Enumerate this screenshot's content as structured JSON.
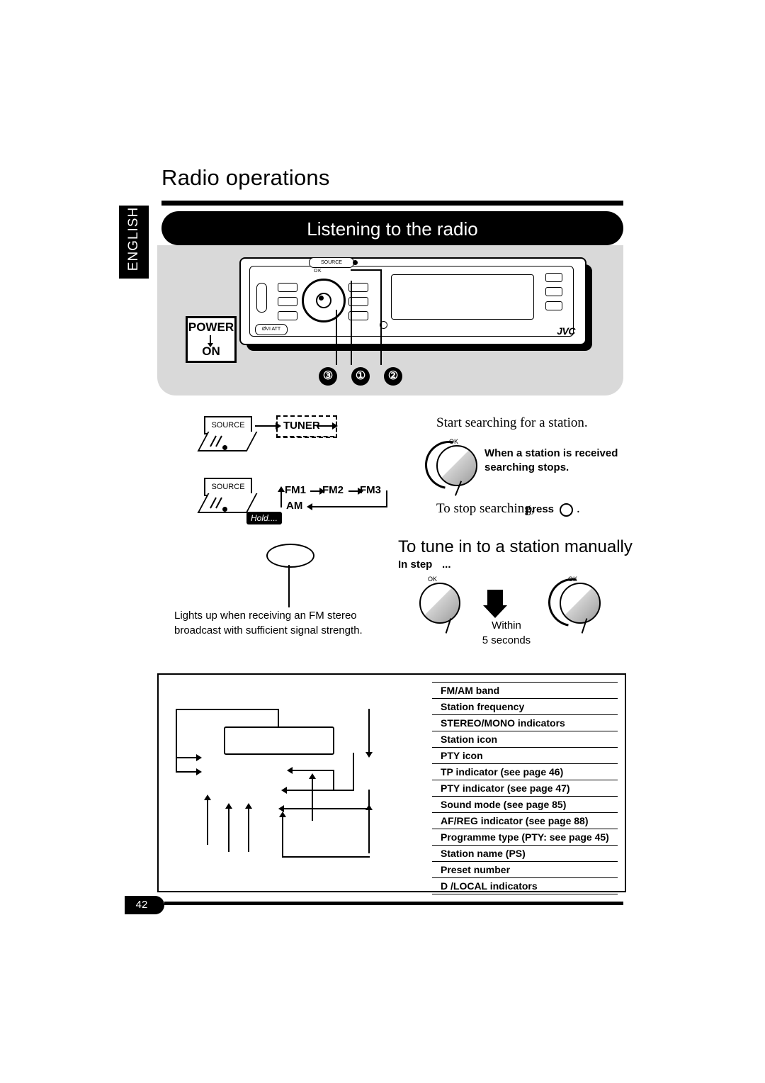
{
  "document": {
    "page_title": "Radio operations",
    "language_tab": "ENGLISH",
    "page_number": "42",
    "banner_title": "Listening to the radio"
  },
  "unit": {
    "power_label": "POWER",
    "power_on": "ON",
    "ok_label": "OK",
    "source_label": "SOURCE",
    "attn_label": "ØVI ATT",
    "brand": "JVC"
  },
  "callouts": {
    "three": "③",
    "one": "①",
    "two": "②"
  },
  "steps": {
    "source_button": "SOURCE",
    "tuner_label": "TUNER",
    "band_fm1": "FM1",
    "band_fm2": "FM2",
    "band_fm3": "FM3",
    "band_am": "AM",
    "hold_badge": "Hold....",
    "start_search": "Start searching for a station.",
    "received_note_line1": "When a station is received",
    "received_note_line2": "searching stops.",
    "stop_search_prefix": "To stop searching,",
    "stop_search_press": "press",
    "stop_search_suffix": ".",
    "ok_label": "OK"
  },
  "manual_tune": {
    "heading": "To tune in to a station manually",
    "in_step": "In step",
    "in_step_dots": "...",
    "within_line1": "Within",
    "within_line2": "5 seconds",
    "ok_label": "OK"
  },
  "stereo_note": {
    "line1": "Lights up when receiving an FM stereo",
    "line2": "broadcast with sufficient signal strength."
  },
  "display_items": [
    "FM/AM band",
    "Station frequency",
    "STEREO/MONO indicators",
    "Station icon",
    "PTY icon",
    "TP indicator (see page 46)",
    "PTY indicator (see page 47)",
    "Sound mode (see page 85)",
    "AF/REG indicator (see page 88)",
    "Programme type (PTY: see page 45)",
    "Station name (PS)",
    "Preset number",
    "D  /LOCAL indicators"
  ],
  "colors": {
    "ink": "#000000",
    "panel_grey": "#d9d9d9",
    "paper": "#ffffff"
  }
}
